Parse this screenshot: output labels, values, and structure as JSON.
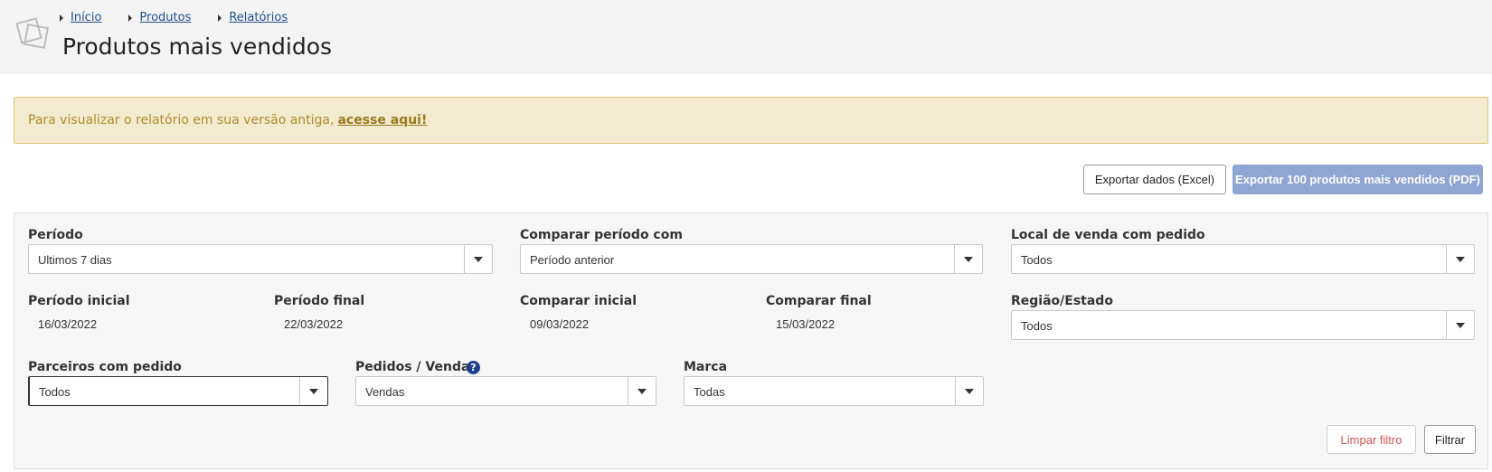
{
  "breadcrumb": [
    {
      "label": "Início"
    },
    {
      "label": "Produtos"
    },
    {
      "label": "Relatórios"
    }
  ],
  "page_title": "Produtos mais vendidos",
  "alert": {
    "text": "Para visualizar o relatório em sua versão antiga,",
    "link": "acesse aqui!"
  },
  "actions": {
    "export_excel": "Exportar dados (Excel)",
    "export_pdf": "Exportar 100 produtos mais vendidos (PDF)"
  },
  "filters": {
    "periodo": {
      "label": "Período",
      "value": "Ultimos 7 dias"
    },
    "comparar": {
      "label": "Comparar período com",
      "value": "Período anterior"
    },
    "local": {
      "label": "Local de venda com pedido",
      "value": "Todos"
    },
    "periodo_inicial": {
      "label": "Período inicial",
      "value": "16/03/2022"
    },
    "periodo_final": {
      "label": "Período final",
      "value": "22/03/2022"
    },
    "comparar_inicial": {
      "label": "Comparar inicial",
      "value": "09/03/2022"
    },
    "comparar_final": {
      "label": "Comparar final",
      "value": "15/03/2022"
    },
    "regiao": {
      "label": "Região/Estado",
      "value": "Todos"
    },
    "parceiros": {
      "label": "Parceiros com pedido",
      "value": "Todos"
    },
    "pedidos": {
      "label": "Pedidos / Vendas",
      "value": "Vendas",
      "help": "?"
    },
    "marca": {
      "label": "Marca",
      "value": "Todas"
    }
  },
  "buttons": {
    "clear": "Limpar filtro",
    "filter": "Filtrar"
  },
  "colors": {
    "primary_button": "#8fa6d4",
    "alert_bg": "#f3ebcf",
    "clear_text": "#d9534f",
    "help_icon": "#1f3f8f"
  }
}
